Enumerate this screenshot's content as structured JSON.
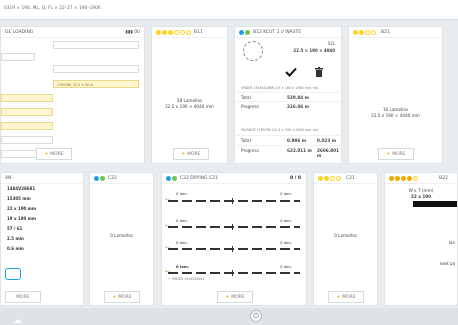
{
  "topbar": {
    "tab": "0319 × 190, ML, Q, FL × 22–27 × 190–1906"
  },
  "card1": {
    "title": "GE LOADING",
    "badge": "▮▮▮ 00",
    "yellow_field_value": "1765780, 22.5 × 90 m",
    "more": "MORE"
  },
  "card2": {
    "title": "B11",
    "lamellas": "28 Lamellas",
    "dims": "22.5 x 190 × 4040 mm",
    "more": "MORE"
  },
  "card3": {
    "title": "B12 KCUT 1 // WASTE",
    "cut_code": "S2L",
    "cut_dims": "22.5 × 190 × 4040",
    "order_label": "ORDER 1549432868 (19 × 180 × 2060 mm, ml)",
    "total_label": "Total",
    "total_value": "529.84 m",
    "progress_label": "Progress",
    "progress_value": "226.06 m",
    "package_label": "PACKAGE 1765780 (22.9 × 190 × 4040 mm, ml)",
    "pkg_total_value1": "0.986 m",
    "pkg_total_value2": "0.023 m",
    "pkg_progress_value1": "622.011 m",
    "pkg_progress_value2": "2606.801 m"
  },
  "card4": {
    "title": "B21",
    "lamellas": "16 Lamellas",
    "dims": "22.5 x 190 × 4040 mm",
    "more": "MORE"
  },
  "card5": {
    "title": "AN",
    "lines": [
      "1484V28681",
      "15305 mm",
      "22 x 190 mm",
      "19 x 180 mm",
      "57 / 61",
      "2.5 min",
      "0.6 min"
    ],
    "more": "MORE"
  },
  "card6": {
    "title": "C22",
    "lamellas": "0 Lamellas",
    "more": "MORE"
  },
  "card7": {
    "title": "C22 DRYING C21",
    "status": "0 / 0",
    "tracks": [
      {
        "left_label": "0 lam.",
        "right_label": "0 lam."
      },
      {
        "left_label": "0 lam.",
        "right_label": "0 lam."
      },
      {
        "left_label": "0 lam.",
        "right_label": "0 lam."
      },
      {
        "left_label": "6 lam.",
        "right_label": "0 lam."
      }
    ],
    "order_note": "+ ORDER 1549432681",
    "more": "MORE"
  },
  "card8": {
    "title": "C21",
    "lamellas": "0 Lamellas",
    "more": "MORE"
  },
  "card9": {
    "title": "B22",
    "info1": "W x T (mm)",
    "info2": "22 x 190",
    "side1": "lan",
    "side2": "next pa"
  }
}
